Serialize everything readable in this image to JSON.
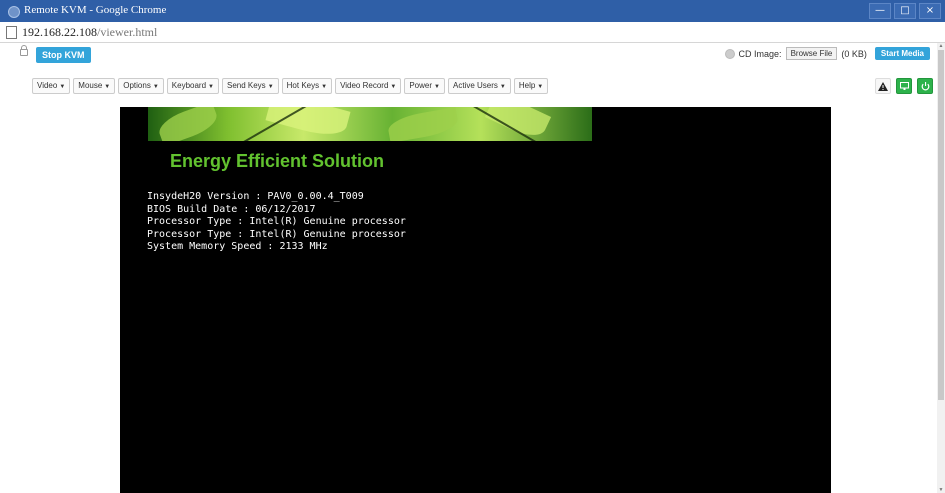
{
  "window": {
    "title": "Remote KVM - Google Chrome",
    "controls": [
      "—",
      "□",
      "×"
    ]
  },
  "address": {
    "host": "192.168.22.108",
    "path": "/viewer.html"
  },
  "kvm": {
    "stop_label": "Stop KVM",
    "cd_label": "CD Image:",
    "browse_label": "Browse File",
    "file_size": "(0 KB)",
    "start_media_label": "Start Media"
  },
  "menu": [
    "Video",
    "Mouse",
    "Options",
    "Keyboard",
    "Send Keys",
    "Hot Keys",
    "Video Record",
    "Power",
    "Active Users",
    "Help"
  ],
  "toolbar_icons": [
    "warning-icon",
    "display-icon",
    "power-icon"
  ],
  "console": {
    "headline": "Energy Efficient Solution",
    "lines": [
      "InsydeH20 Version : PAV0_0.00.4_T009",
      "BIOS Build Date : 06/12/2017",
      "Processor Type : Intel(R) Genuine processor",
      "Processor Type : Intel(R) Genuine processor",
      "System Memory Speed : 2133 MHz"
    ]
  },
  "colors": {
    "accent": "#33a4da",
    "power_green": "#2db24b",
    "headline_green": "#62c22f"
  }
}
